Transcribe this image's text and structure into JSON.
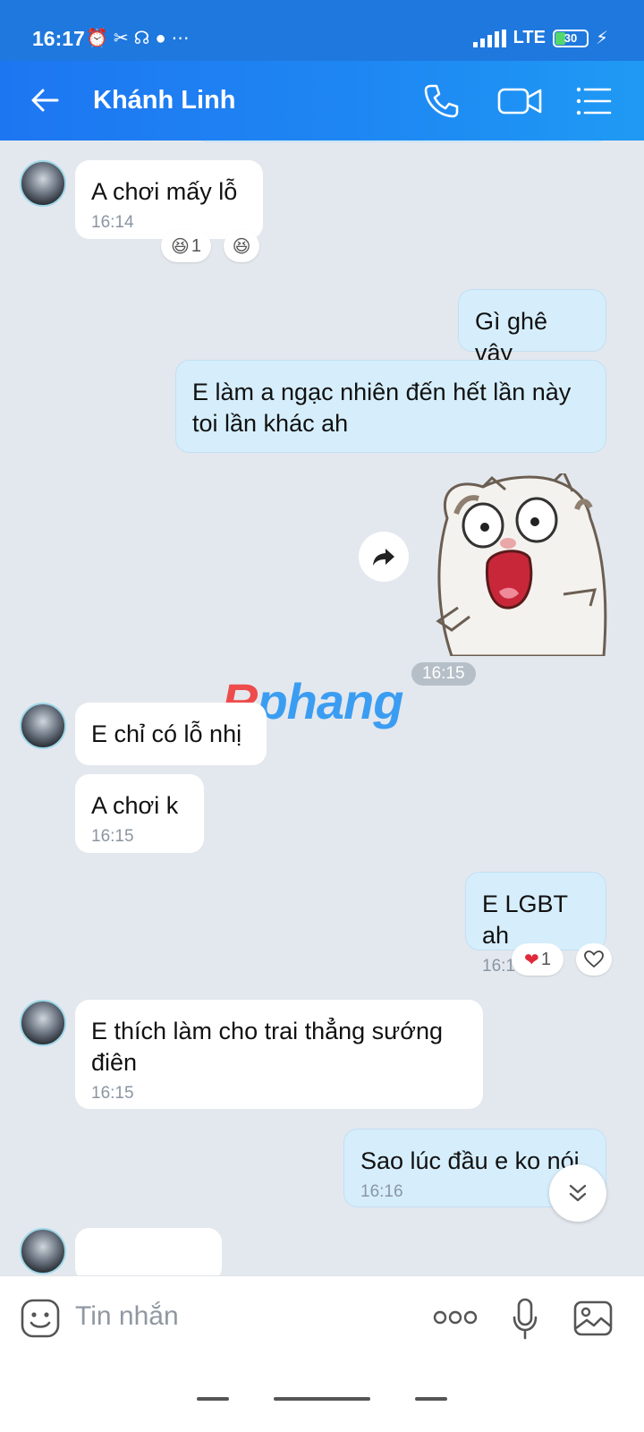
{
  "status_bar": {
    "time": "16:17",
    "network": "LTE",
    "battery": "30",
    "battery_fraction": 0.3
  },
  "header": {
    "contact_name": "Khánh Linh",
    "icons": [
      "arrow-left-icon",
      "phone-icon",
      "video-camera-icon",
      "menu-list-icon"
    ]
  },
  "messages": [
    {
      "side": "in",
      "text": "A chơi mấy lỗ",
      "time": "16:14",
      "reactions": [
        {
          "emoji": "laugh-emoji",
          "count": "1"
        },
        {
          "emoji": "laugh-emoji",
          "count": ""
        }
      ]
    },
    {
      "side": "out",
      "text": "Gì ghê vậy"
    },
    {
      "side": "out",
      "text": "E làm a ngạc nhiên đến hết lần này toi lần khác ah"
    },
    {
      "side": "out",
      "type": "sticker",
      "time": "16:15"
    },
    {
      "side": "in",
      "text": "E chỉ có lỗ nhị"
    },
    {
      "side": "in",
      "text": "A chơi k",
      "time": "16:15"
    },
    {
      "side": "out",
      "text": "E LGBT ah",
      "time": "16:15",
      "reactions": [
        {
          "emoji": "heart-emoji",
          "count": "1"
        }
      ]
    },
    {
      "side": "in",
      "text": "E thích làm cho trai thẳng sướng điên",
      "time": "16:15"
    },
    {
      "side": "out",
      "text": "Sao lúc đầu e ko nói",
      "time": "16:16"
    }
  ],
  "watermark": {
    "part1": "R",
    "part2": "phang"
  },
  "composer": {
    "placeholder": "Tin nhắn"
  },
  "colors": {
    "header": "#1e88f3",
    "out_bubble": "#d6eefc",
    "in_bubble": "#ffffff",
    "background": "#e3e8ee"
  }
}
